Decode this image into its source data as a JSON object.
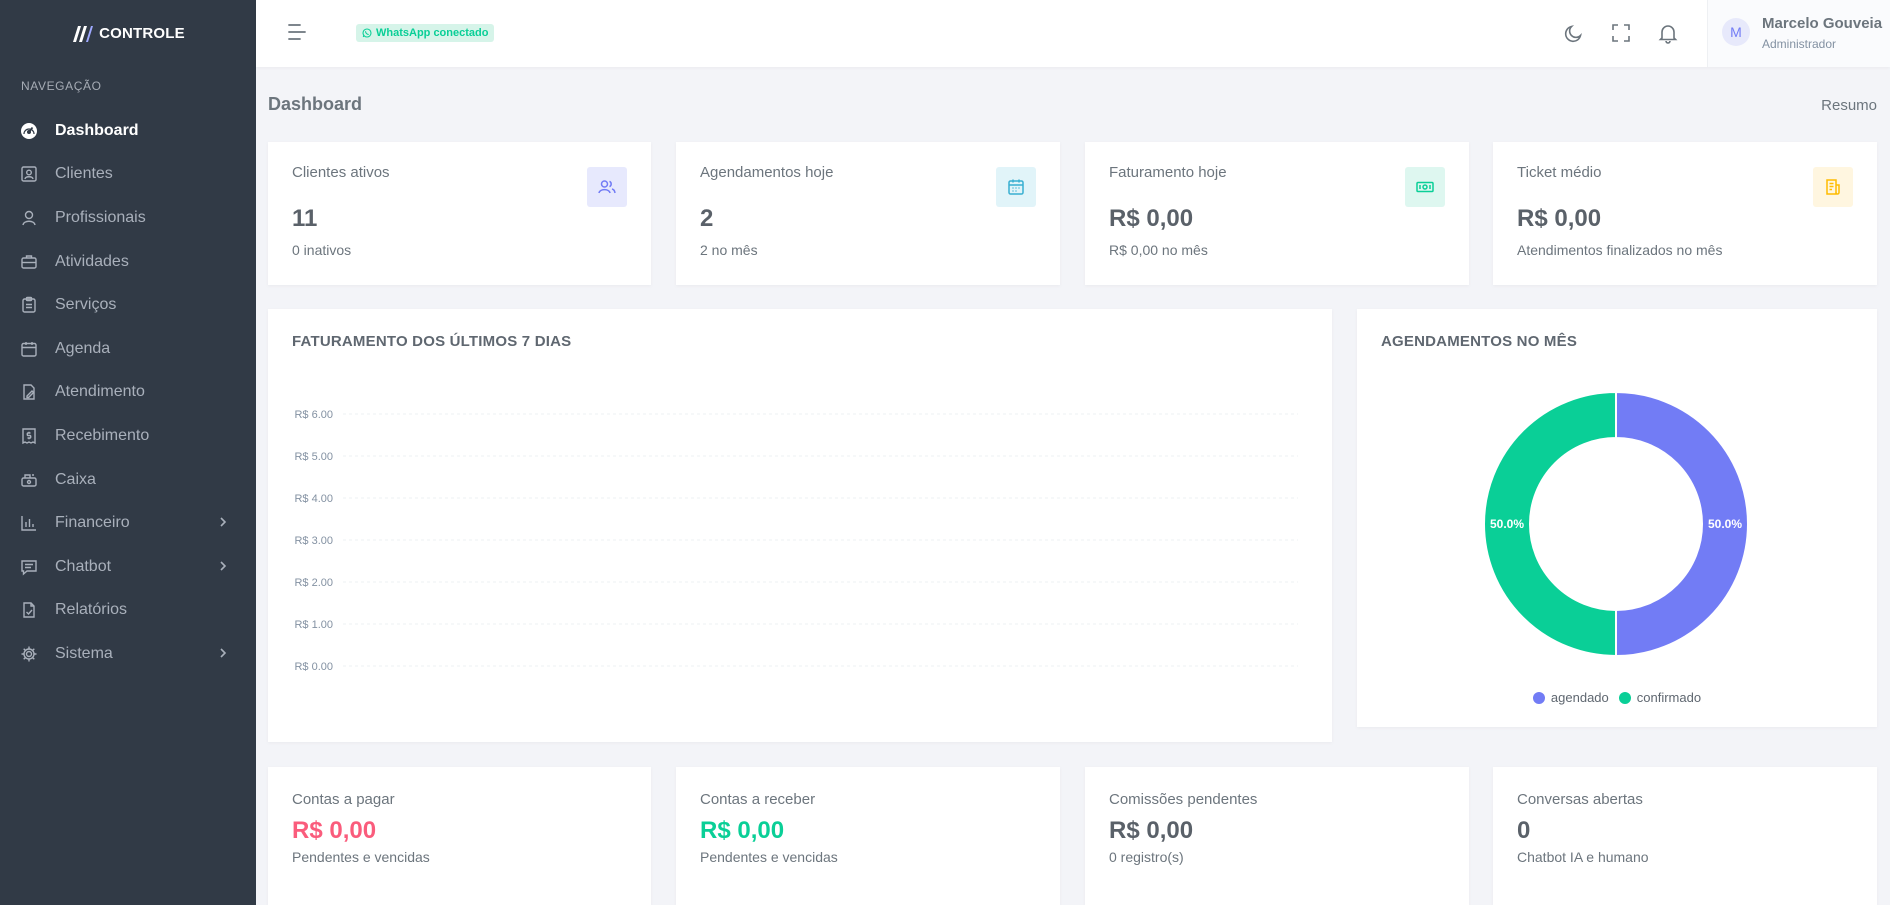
{
  "brand": {
    "name": "CONTROLE"
  },
  "sidebar": {
    "section_title": "NAVEGAÇÃO",
    "items": [
      {
        "label": "Dashboard",
        "icon": "dashboard-icon",
        "active": true
      },
      {
        "label": "Clientes",
        "icon": "contact-card-icon"
      },
      {
        "label": "Profissionais",
        "icon": "user-icon"
      },
      {
        "label": "Atividades",
        "icon": "briefcase-icon"
      },
      {
        "label": "Serviços",
        "icon": "clipboard-icon"
      },
      {
        "label": "Agenda",
        "icon": "calendar-icon"
      },
      {
        "label": "Atendimento",
        "icon": "file-edit-icon"
      },
      {
        "label": "Recebimento",
        "icon": "receipt-dollar-icon"
      },
      {
        "label": "Caixa",
        "icon": "cash-register-icon"
      },
      {
        "label": "Financeiro",
        "icon": "bar-chart-icon",
        "has_submenu": true
      },
      {
        "label": "Chatbot",
        "icon": "chat-icon",
        "has_submenu": true
      },
      {
        "label": "Relatórios",
        "icon": "report-icon"
      },
      {
        "label": "Sistema",
        "icon": "gear-icon",
        "has_submenu": true
      }
    ]
  },
  "topbar": {
    "whatsapp_status": "WhatsApp conectado",
    "user": {
      "initial": "M",
      "name": "Marcelo Gouveia",
      "role": "Administrador"
    }
  },
  "page": {
    "title": "Dashboard",
    "breadcrumb": "Resumo"
  },
  "stats": [
    {
      "label": "Clientes ativos",
      "value": "11",
      "sub": "0 inativos",
      "icon": "users-icon",
      "icon_color": "#727cf5",
      "icon_bg": "#e7e9fd"
    },
    {
      "label": "Agendamentos hoje",
      "value": "2",
      "sub": "2 no mês",
      "icon": "calendar-icon",
      "icon_color": "#39afd1",
      "icon_bg": "#e1f4f9"
    },
    {
      "label": "Faturamento hoje",
      "value": "R$ 0,00",
      "sub": "R$ 0,00 no mês",
      "icon": "money-icon",
      "icon_color": "#0acf97",
      "icon_bg": "#def7f0"
    },
    {
      "label": "Ticket médio",
      "value": "R$ 0,00",
      "sub": "Atendimentos finalizados no mês",
      "icon": "receipt-icon",
      "icon_color": "#ffbc00",
      "icon_bg": "#fff6e0"
    }
  ],
  "revenue_chart_title": "FATURAMENTO DOS ÚLTIMOS 7 DIAS",
  "appointments_chart_title": "AGENDAMENTOS NO MÊS",
  "chart_data": [
    {
      "type": "line",
      "title": "FATURAMENTO DOS ÚLTIMOS 7 DIAS",
      "ylim": [
        0,
        6
      ],
      "y_ticks": [
        "R$ 6.00",
        "R$ 5.00",
        "R$ 4.00",
        "R$ 3.00",
        "R$ 2.00",
        "R$ 1.00",
        "R$ 0.00"
      ],
      "grid": true,
      "series": []
    },
    {
      "type": "pie",
      "title": "AGENDAMENTOS NO MÊS",
      "donut": true,
      "legend_position": "bottom",
      "slices": [
        {
          "label": "agendado",
          "value": 50.0,
          "display": "50.0%",
          "color": "#727cf5"
        },
        {
          "label": "confirmado",
          "value": 50.0,
          "display": "50.0%",
          "color": "#0acf97"
        }
      ]
    }
  ],
  "bottom": [
    {
      "label": "Contas a pagar",
      "value": "R$ 0,00",
      "sub": "Pendentes e vencidas",
      "tone": "danger"
    },
    {
      "label": "Contas a receber",
      "value": "R$ 0,00",
      "sub": "Pendentes e vencidas",
      "tone": "success"
    },
    {
      "label": "Comissões pendentes",
      "value": "R$ 0,00",
      "sub": "0 registro(s)",
      "tone": ""
    },
    {
      "label": "Conversas abertas",
      "value": "0",
      "sub": "Chatbot IA e humano",
      "tone": ""
    }
  ]
}
